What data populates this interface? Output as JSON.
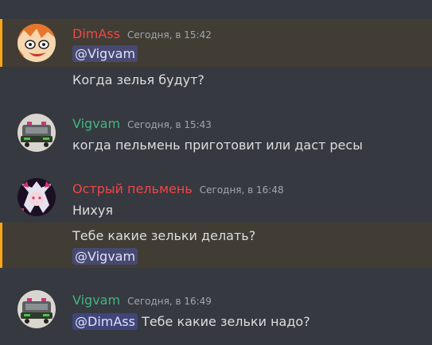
{
  "colors": {
    "background": "#36393f",
    "highlight_bg": "#413d34",
    "highlight_bar": "#faa61a",
    "username_red": "#f04747",
    "username_green": "#43b581",
    "text": "#dcddde",
    "timestamp": "#a3a6aa",
    "mention_bg": "#4e5397"
  },
  "messages": [
    {
      "author": "DimAss",
      "author_color": "#f04747",
      "timestamp": "Сегодня, в 15:42",
      "avatar": "anime-face-avatar",
      "lines": [
        {
          "mention": "@Vigvam",
          "text": ""
        },
        {
          "mention": "",
          "text": "Когда зелья будут?"
        }
      ]
    },
    {
      "author": "Vigvam",
      "author_color": "#43b581",
      "timestamp": "Сегодня, в 15:43",
      "avatar": "car-avatar",
      "lines": [
        {
          "mention": "",
          "text": "когда пельмень приготовит или даст ресы"
        }
      ]
    },
    {
      "author": "Острый пельмень",
      "author_color": "#f04747",
      "timestamp": "Сегодня, в 16:48",
      "avatar": "anime-girl-avatar",
      "lines": [
        {
          "mention": "",
          "text": "Нихуя"
        },
        {
          "mention": "",
          "text": "Тебе какие зельки делать?"
        },
        {
          "mention": "@Vigvam",
          "text": ""
        }
      ]
    },
    {
      "author": "Vigvam",
      "author_color": "#43b581",
      "timestamp": "Сегодня, в 16:49",
      "avatar": "car-avatar",
      "lines": [
        {
          "mention": "@DimAss",
          "text": "Тебе какие зельки надо?"
        }
      ]
    }
  ]
}
